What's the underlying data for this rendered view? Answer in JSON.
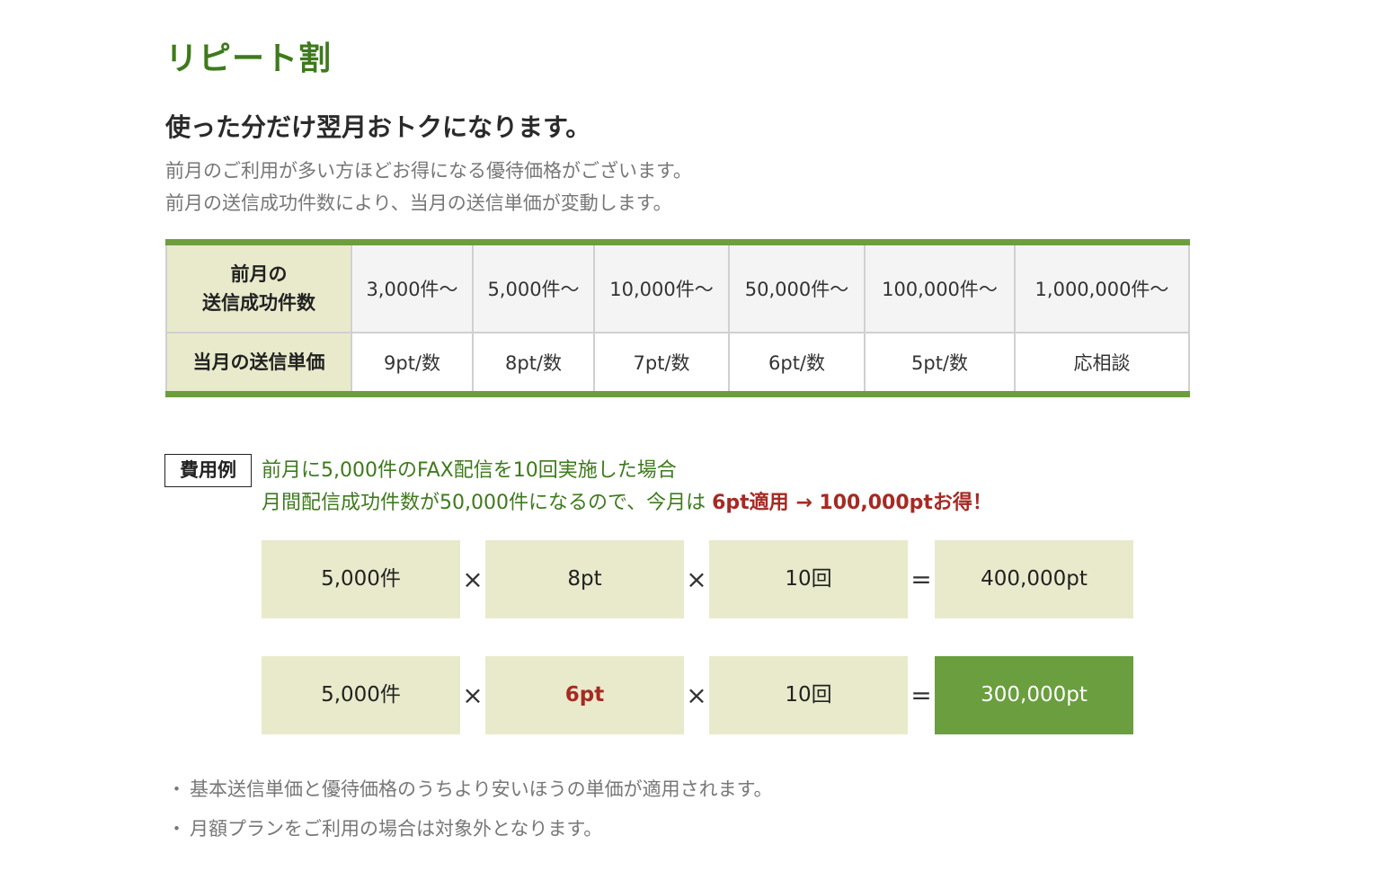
{
  "section_title": "リピート割",
  "headline": "使った分だけ翌月おトクになります。",
  "intro": [
    "前月のご利用が多い方ほどお得になる優待価格がございます。",
    "前月の送信成功件数により、当月の送信単価が変動します。"
  ],
  "table": {
    "row_count_header": [
      "前月の",
      "送信成功件数"
    ],
    "row_price_header": "当月の送信単価",
    "counts": [
      "3,000件～",
      "5,000件～",
      "10,000件～",
      "50,000件～",
      "100,000件～",
      "1,000,000件～"
    ],
    "prices": [
      "9pt/数",
      "8pt/数",
      "7pt/数",
      "6pt/数",
      "5pt/数",
      "応相談"
    ]
  },
  "example": {
    "badge": "費用例",
    "line1": "前月に5,000件のFAX配信を10回実施した場合",
    "line2_prefix": "月間配信成功件数が50,000件になるので、今月は ",
    "line2_emphasis": "6pt適用 → 100,000ptお得！"
  },
  "calculations": [
    {
      "count": "5,000件",
      "op1": "×",
      "unit": "8pt",
      "op2": "×",
      "times": "10回",
      "eq": "=",
      "total": "400,000pt"
    },
    {
      "count": "5,000件",
      "op1": "×",
      "unit": "6pt",
      "op2": "×",
      "times": "10回",
      "eq": "=",
      "total": "300,000pt"
    }
  ],
  "notes": [
    "基本送信単価と優待価格のうちより安いほうの単価が適用されます。",
    "月額プランをご利用の場合は対象外となります。"
  ],
  "colors": {
    "accent_green": "#6a9e3f",
    "title_green": "#3e7a1c",
    "beige": "#e9eacb",
    "emphasis_red": "#a52a23"
  }
}
